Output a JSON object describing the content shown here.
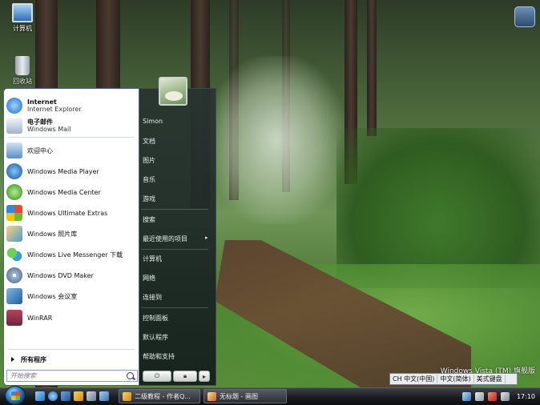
{
  "desktop": {
    "icons": [
      {
        "label": "计算机",
        "icon": "computer-icon"
      },
      {
        "label": "回收站",
        "icon": "recycle-bin-icon"
      }
    ],
    "watermark": "Windows Vista (TM) 旗舰版"
  },
  "start_menu": {
    "pinned": [
      {
        "title": "Internet",
        "subtitle": "Internet Explorer",
        "icon": "internet-explorer-icon"
      },
      {
        "title": "电子邮件",
        "subtitle": "Windows Mail",
        "icon": "windows-mail-icon"
      }
    ],
    "recent": [
      {
        "label": "欢迎中心",
        "icon": "welcome-center-icon"
      },
      {
        "label": "Windows Media Player",
        "icon": "media-player-icon"
      },
      {
        "label": "Windows Media Center",
        "icon": "media-center-icon"
      },
      {
        "label": "Windows Ultimate Extras",
        "icon": "ultimate-extras-icon"
      },
      {
        "label": "Windows 照片库",
        "icon": "photo-gallery-icon"
      },
      {
        "label": "Windows Live Messenger 下载",
        "icon": "messenger-icon"
      },
      {
        "label": "Windows DVD Maker",
        "icon": "dvd-maker-icon"
      },
      {
        "label": "Windows 会议室",
        "icon": "meeting-space-icon"
      },
      {
        "label": "WinRAR",
        "icon": "winrar-icon"
      }
    ],
    "all_programs": "所有程序",
    "search_placeholder": "开始搜索",
    "right_items": {
      "user": "Simon",
      "documents": "文档",
      "pictures": "图片",
      "music": "音乐",
      "games": "游戏",
      "search": "搜索",
      "recent_items": "最近使用的项目",
      "computer": "计算机",
      "network": "网络",
      "connect_to": "连接到",
      "control_panel": "控制面板",
      "default_programs": "默认程序",
      "help": "帮助和支持"
    }
  },
  "taskbar": {
    "tasks": [
      {
        "label": "二级教程 - 作者Q...",
        "icon": "folder-icon"
      },
      {
        "label": "无标题 - 画图",
        "icon": "paint-icon"
      }
    ],
    "language_bar": [
      "CH 中文(中国)",
      "中文(简体)",
      "美式键盘"
    ],
    "clock": "17:10"
  }
}
